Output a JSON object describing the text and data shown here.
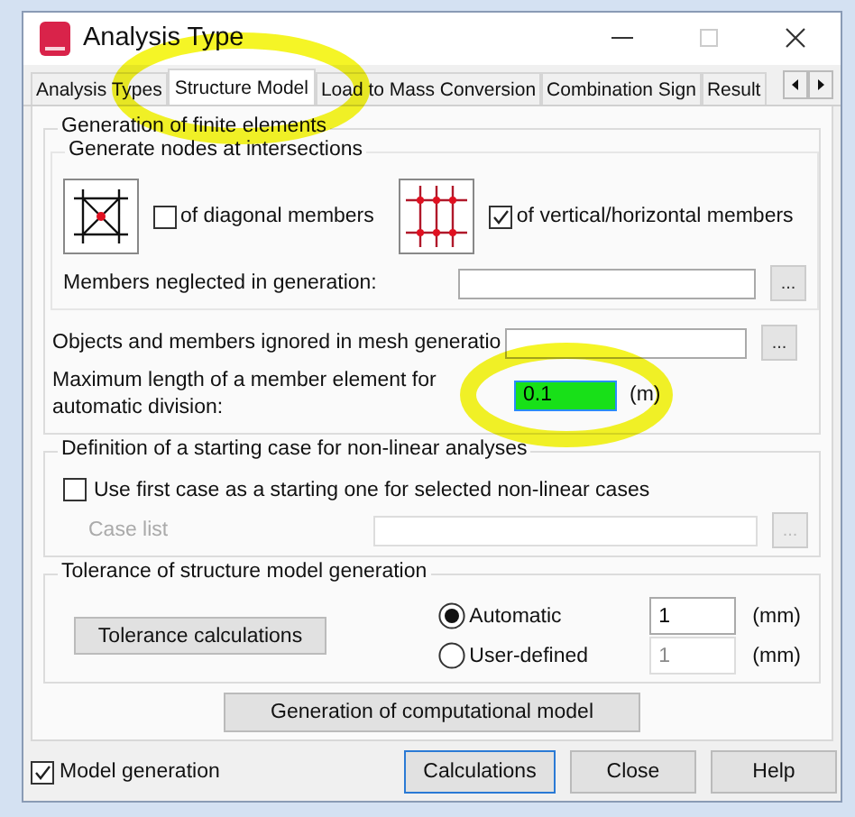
{
  "window": {
    "title": "Analysis Type"
  },
  "tabs": [
    {
      "label": "Analysis Types",
      "selected": false
    },
    {
      "label": "Structure Model",
      "selected": true,
      "highlighted": true
    },
    {
      "label": "Load to Mass Conversion",
      "selected": false
    },
    {
      "label": "Combination Sign",
      "selected": false
    },
    {
      "label": "Result",
      "selected": false
    }
  ],
  "finite_elements": {
    "title": "Generation of finite elements",
    "nodes": {
      "title": "Generate nodes at intersections",
      "options": [
        {
          "kind": "diagonal",
          "label": "of diagonal members",
          "checked": false
        },
        {
          "kind": "grid",
          "label": "of vertical/horizontal members",
          "checked": true
        }
      ]
    },
    "neglected": {
      "label": "Members neglected in generation:",
      "button": "..."
    },
    "ignored": {
      "label": "Objects and members ignored in mesh generatio",
      "button": "..."
    },
    "max_length": {
      "label": "Maximum length of a member element for automatic division:",
      "value": "0.1",
      "unit": "(m)",
      "highlighted": true
    }
  },
  "starting_case": {
    "title": "Definition of a starting case for non-linear analyses",
    "option": {
      "label": "Use first case as a starting one for selected non-linear cases",
      "checked": false
    },
    "case_list": {
      "label": "Case list",
      "button": "...",
      "disabled": true
    }
  },
  "tolerance": {
    "title": "Tolerance of structure model generation",
    "button": "Tolerance calculations",
    "modes": [
      {
        "label": "Automatic",
        "selected": true,
        "value": "1",
        "unit": "(mm)"
      },
      {
        "label": "User-defined",
        "selected": false,
        "value": "1",
        "unit": "(mm)"
      }
    ]
  },
  "generate_button": "Generation of computational model",
  "footer": {
    "model_generation": {
      "label": "Model generation",
      "checked": true
    },
    "buttons": [
      {
        "label": "Calculations",
        "default": true
      },
      {
        "label": "Close",
        "default": false
      },
      {
        "label": "Help",
        "default": false
      }
    ]
  }
}
